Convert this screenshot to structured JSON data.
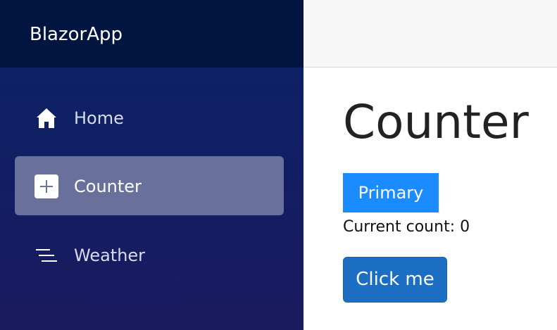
{
  "brand": {
    "title": "BlazorApp"
  },
  "sidebar": {
    "items": [
      {
        "label": "Home",
        "icon": "home-icon",
        "active": false
      },
      {
        "label": "Counter",
        "icon": "plus-square-icon",
        "active": true
      },
      {
        "label": "Weather",
        "icon": "list-icon",
        "active": false
      }
    ]
  },
  "main": {
    "title": "Counter",
    "primary_button_label": "Primary",
    "count_text": "Current count: 0",
    "click_button_label": "Click me"
  },
  "colors": {
    "sidebar_top": "#011540",
    "sidebar_gradient_start": "#0a2368",
    "sidebar_gradient_end": "#1a1a5e",
    "primary_button": "#1b8cff",
    "click_button": "#1b6ec2",
    "topbar": "#f7f7f7"
  }
}
